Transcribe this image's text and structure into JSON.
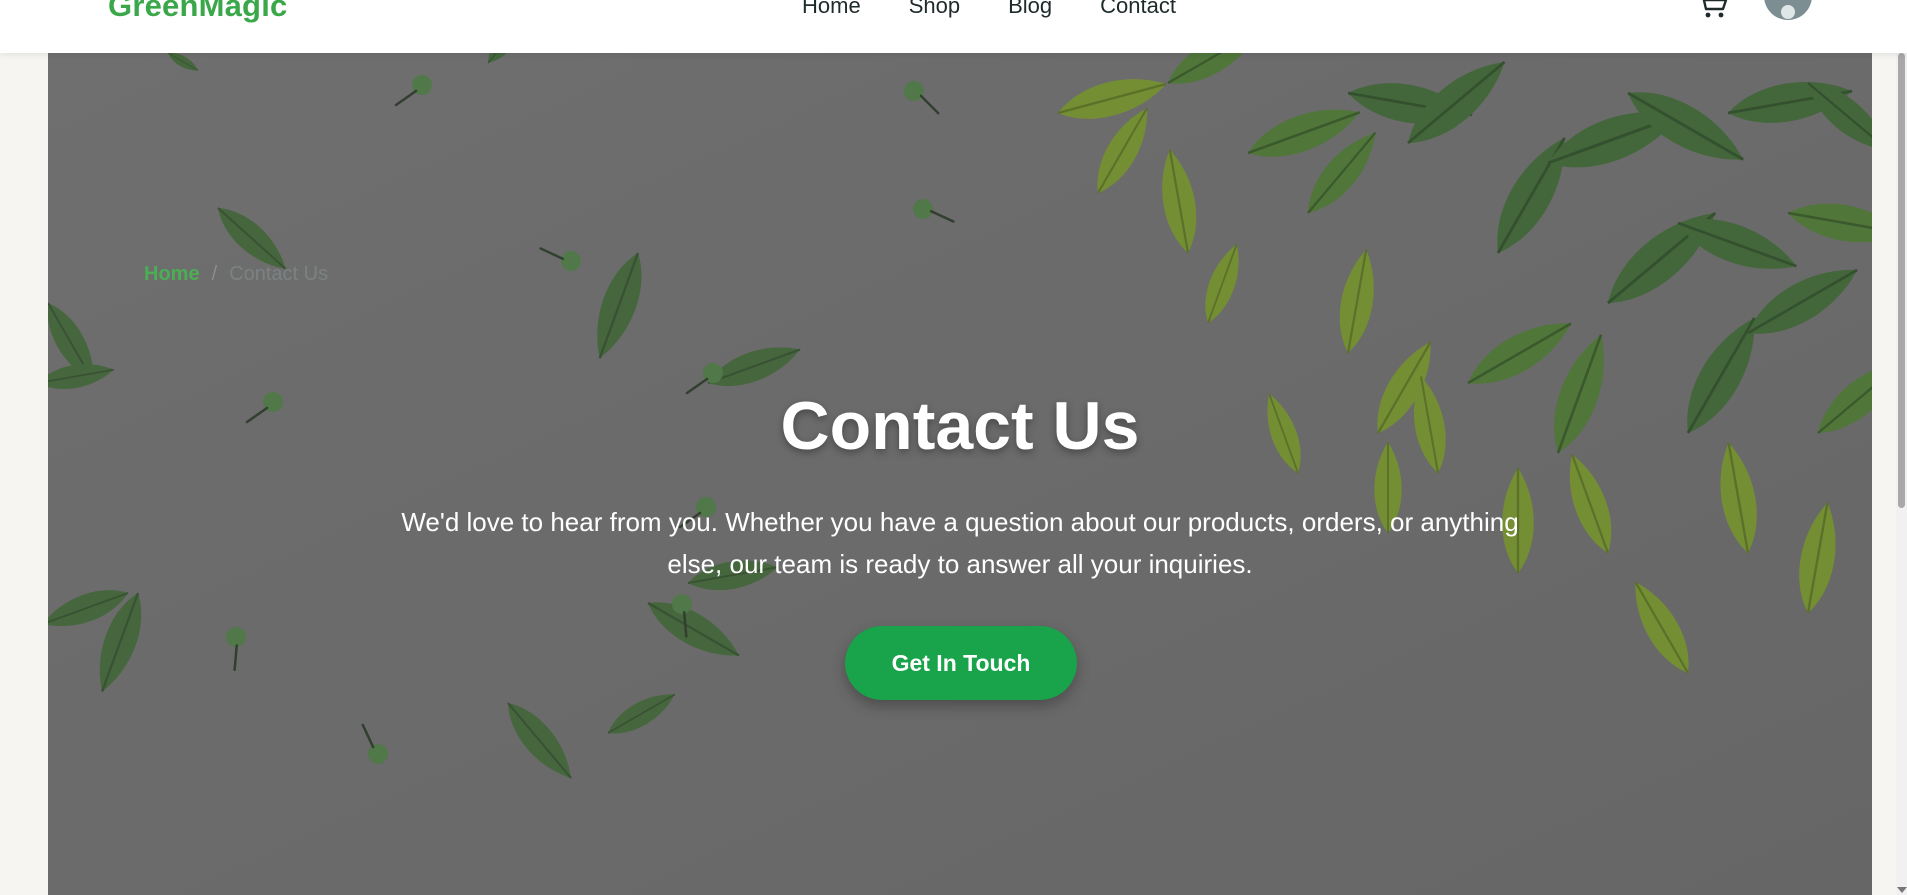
{
  "brand": {
    "name": "GreenMagic",
    "color": "#3aa84a"
  },
  "nav": {
    "items": [
      "Home",
      "Shop",
      "Blog",
      "Contact"
    ]
  },
  "header": {
    "cart_icon": "cart-icon",
    "avatar_icon": "user-avatar"
  },
  "breadcrumb": {
    "home": "Home",
    "separator": "/",
    "current": "Contact Us"
  },
  "hero": {
    "title": "Contact Us",
    "description": "We'd love to hear from you. Whether you have a question about our products, orders, or anything else, our team is ready to answer all your inquiries.",
    "cta_label": "Get In Touch",
    "cta_color": "#19a34a",
    "background": "leaves-photo"
  }
}
